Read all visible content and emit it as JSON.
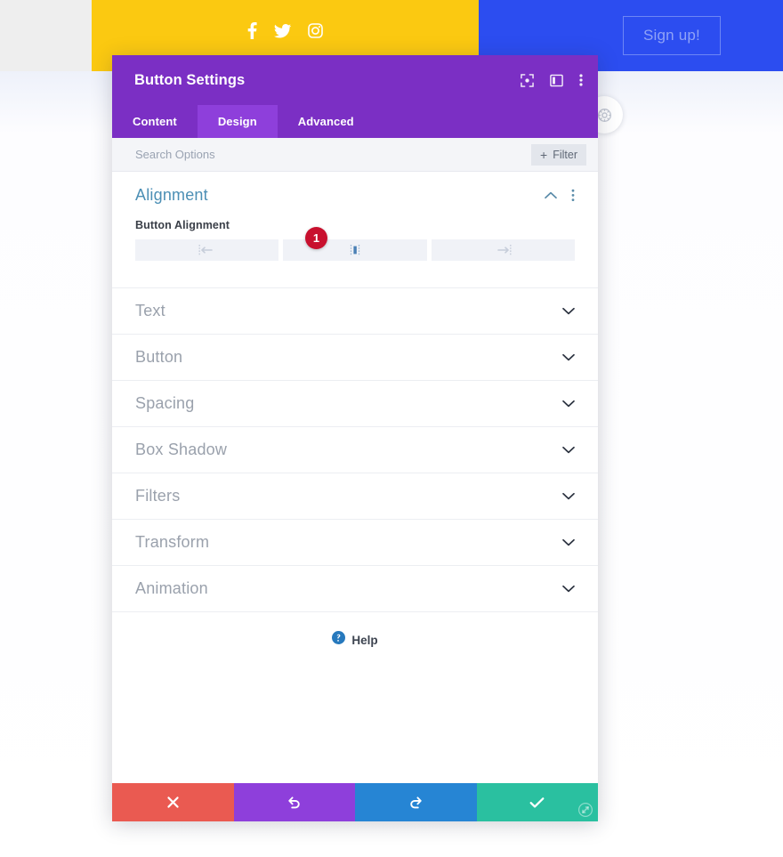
{
  "background": {
    "social_icons": [
      {
        "name": "facebook-icon",
        "label": "Facebook"
      },
      {
        "name": "twitter-icon",
        "label": "Twitter"
      },
      {
        "name": "instagram-icon",
        "label": "Instagram"
      }
    ],
    "signup_button_label": "Sign up!",
    "colors": {
      "yellow_bar": "#fbc911",
      "blue_bar": "#2c4df0",
      "left_block": "#eeeeee",
      "signup_border": "#6d86f5",
      "signup_text": "#8fa2f7"
    }
  },
  "modal": {
    "title": "Button Settings",
    "header_icons": [
      {
        "name": "focus-target-icon",
        "label": "Focus"
      },
      {
        "name": "panel-layout-icon",
        "label": "Layout"
      },
      {
        "name": "more-vertical-icon",
        "label": "More options"
      }
    ],
    "tabs": [
      {
        "label": "Content",
        "active": false
      },
      {
        "label": "Design",
        "active": true
      },
      {
        "label": "Advanced",
        "active": false
      }
    ],
    "search": {
      "value": "",
      "placeholder": "Search Options"
    },
    "filter_button": {
      "label": "Filter",
      "plus": "+"
    },
    "alignment_group": {
      "title": "Alignment",
      "expanded": true,
      "field_label": "Button Alignment",
      "options": [
        {
          "name": "align-left-icon",
          "label": "Left",
          "selected": false
        },
        {
          "name": "align-center-icon",
          "label": "Center",
          "selected": true
        },
        {
          "name": "align-right-icon",
          "label": "Right",
          "selected": false
        }
      ],
      "callout_badge": "1"
    },
    "collapsed_groups": [
      {
        "label": "Text"
      },
      {
        "label": "Button"
      },
      {
        "label": "Spacing"
      },
      {
        "label": "Box Shadow"
      },
      {
        "label": "Filters"
      },
      {
        "label": "Transform"
      },
      {
        "label": "Animation"
      }
    ],
    "help": {
      "label": "Help",
      "icon": "help-circle-icon"
    },
    "footer_buttons": [
      {
        "name": "cancel-button",
        "icon": "close-icon",
        "color": "#ea5a51",
        "label": "Cancel"
      },
      {
        "name": "undo-button",
        "icon": "undo-icon",
        "color": "#8e3fdb",
        "label": "Undo"
      },
      {
        "name": "redo-button",
        "icon": "redo-icon",
        "color": "#2685d4",
        "label": "Redo"
      },
      {
        "name": "save-button",
        "icon": "check-icon",
        "color": "#2ac0a0",
        "label": "Save"
      }
    ],
    "colors": {
      "header": "#7b2fc4",
      "tab_active": "#8e3fdb",
      "group_title": "#4c8fb5",
      "callout": "#c8102e"
    }
  }
}
